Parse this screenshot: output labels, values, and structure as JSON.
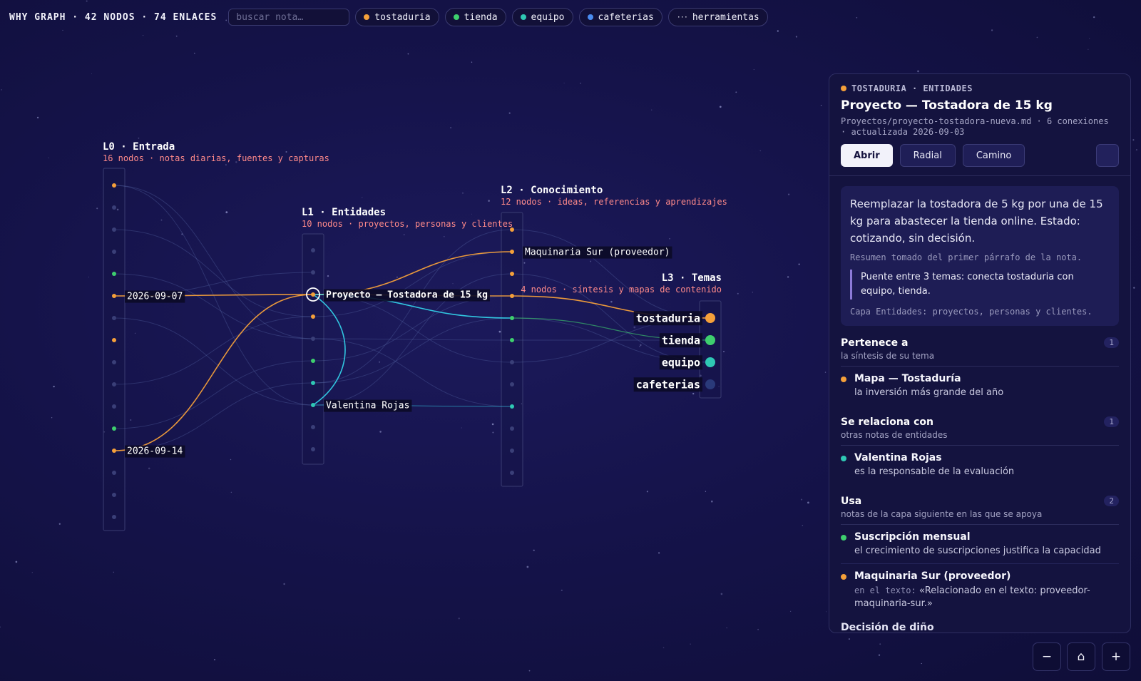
{
  "topbar": {
    "title": "WHY GRAPH · 42 NODOS · 74 ENLACES",
    "search_placeholder": "buscar nota…",
    "filters": [
      {
        "label": "tostaduria",
        "color": "#f5a03a"
      },
      {
        "label": "tienda",
        "color": "#3ecf6e"
      },
      {
        "label": "equipo",
        "color": "#2fc8b4"
      },
      {
        "label": "cafeterias",
        "color": "#4a8cf0"
      },
      {
        "label": "herramientas",
        "icon": "ellipsis-icon",
        "glyph": "···"
      }
    ]
  },
  "colors": {
    "tostaduria": "#f5a03a",
    "tienda": "#3ecf6e",
    "equipo": "#2fc8b4",
    "cafeterias": "#2a3a7a",
    "entity_link": "#33d0e8",
    "empty_node": "#3a3f78",
    "layer_subtitle": "#ff8a8a"
  },
  "graph": {
    "layers": [
      {
        "title": "L0 · Entrada",
        "subtitle": "16 nodos · notas diarias, fuentes y capturas"
      },
      {
        "title": "L1 · Entidades",
        "subtitle": "10 nodos · proyectos, personas y clientes"
      },
      {
        "title": "L2 · Conocimiento",
        "subtitle": "12 nodos · ideas, referencias y aprendizajes"
      },
      {
        "title": "L3 · Temas",
        "subtitle": "4 nodos · síntesis y mapas de contenido"
      }
    ],
    "node_labels": {
      "date1": "2026-09-07",
      "date2": "2026-09-14",
      "project": "Proyecto — Tostadora de 15 kg",
      "person": "Valentina Rojas",
      "supplier": "Maquinaria Sur (proveedor)",
      "topic1": "tostaduria",
      "topic2": "tienda",
      "topic3": "equipo",
      "topic4": "cafeterias"
    }
  },
  "panel": {
    "kicker": "TOSTADURIA · ENTIDADES",
    "kicker_color": "#f5a03a",
    "title": "Proyecto — Tostadora de 15 kg",
    "meta": "Proyectos/proyecto-tostadora-nueva.md · 6 conexiones · actualizada 2026-09-03",
    "buttons": {
      "open": "Abrir",
      "radial": "Radial",
      "path": "Camino"
    },
    "summary": "Reemplazar la tostadora de 5 kg por una de 15 kg para abastecer la tienda online. Estado: cotizando, sin decisión.",
    "summary_source": "Resumen tomado del primer párrafo de la nota.",
    "bridge": "Puente entre 3 temas: conecta tostaduria con equipo, tienda.",
    "layer_note": "Capa Entidades: proyectos, personas y clientes.",
    "sections": [
      {
        "title": "Pertenece a",
        "subtitle": "la síntesis de su tema",
        "count": "1",
        "items": [
          {
            "title": "Mapa — Tostaduría",
            "desc": "la inversión más grande del año",
            "color": "#f5a03a"
          }
        ]
      },
      {
        "title": "Se relaciona con",
        "subtitle": "otras notas de entidades",
        "count": "1",
        "items": [
          {
            "title": "Valentina Rojas",
            "desc": "es la responsable de la evaluación",
            "color": "#2fc8b4"
          }
        ]
      },
      {
        "title": "Usa",
        "subtitle": "notas de la capa siguiente en las que se apoya",
        "count": "2",
        "items": [
          {
            "title": "Suscripción mensual",
            "desc": "el crecimiento de suscripciones justifica la capacidad",
            "color": "#3ecf6e"
          },
          {
            "title": "Maquinaria Sur (proveedor)",
            "tag": "en el texto:",
            "desc": "«Relacionado en el texto: proveedor-maquinaria-sur.»",
            "color": "#f5a03a"
          }
        ]
      }
    ],
    "cut_section_title": "Decisión de diño"
  },
  "zoom": {
    "out": "−",
    "home": "⌂",
    "in": "+"
  }
}
